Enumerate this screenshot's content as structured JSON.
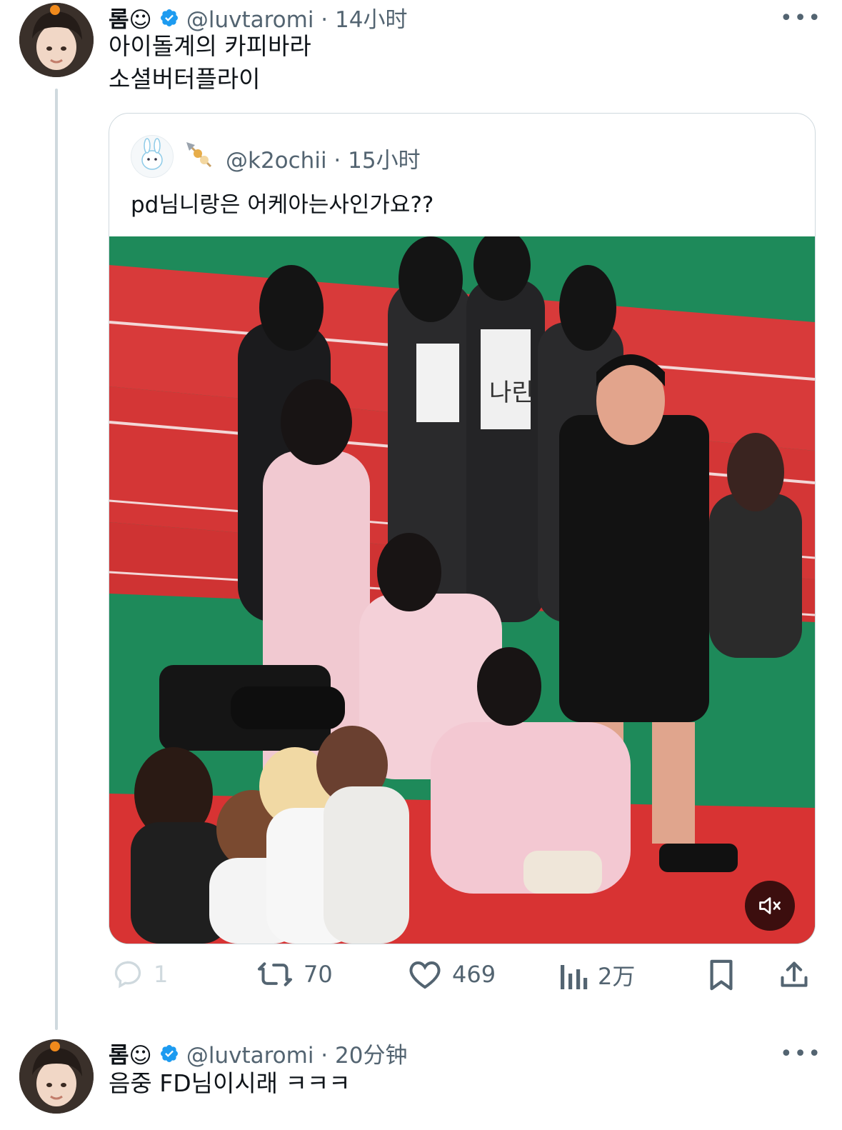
{
  "tweet1": {
    "display_name": "롬☺",
    "handle_time": "@luvtaromi · 14小时",
    "lines": [
      "아이돌계의 카피바라",
      "소셜버터플라이"
    ],
    "more": "•••",
    "stats": {
      "replies": "1",
      "retweets": "70",
      "likes": "469",
      "views": "2万"
    }
  },
  "quote": {
    "handle_time": "@k2ochii · 15小时",
    "text": "pd님니랑은 어케아는사인가요??",
    "bib_text": "나린"
  },
  "tweet2": {
    "display_name": "롬☺",
    "handle_time": "@luvtaromi · 20分钟",
    "text": "음중 FD님이시래 ㅋㅋㅋ",
    "more": "•••"
  },
  "colors": {
    "verified": "#1d9bf0",
    "text": "#0f1419",
    "muted": "#536471",
    "border": "#cfd9de"
  },
  "icons": [
    "reply-icon",
    "retweet-icon",
    "like-icon",
    "views-icon",
    "bookmark-icon",
    "share-icon",
    "mute-icon",
    "verified-icon"
  ]
}
